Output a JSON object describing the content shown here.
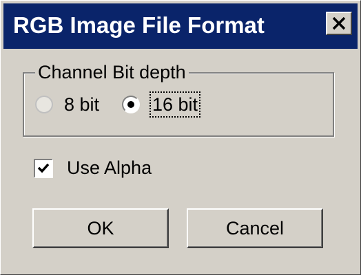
{
  "window": {
    "title": "RGB Image File Format",
    "close_glyph": "close-icon"
  },
  "channel_group": {
    "legend": "Channel Bit depth",
    "options": [
      {
        "label": "8 bit",
        "selected": false
      },
      {
        "label": "16 bit",
        "selected": true
      }
    ]
  },
  "use_alpha": {
    "label": "Use Alpha",
    "checked": true
  },
  "buttons": {
    "ok_label": "OK",
    "cancel_label": "Cancel"
  },
  "colors": {
    "titlebar": "#0a246a",
    "face": "#d4d0c8"
  }
}
